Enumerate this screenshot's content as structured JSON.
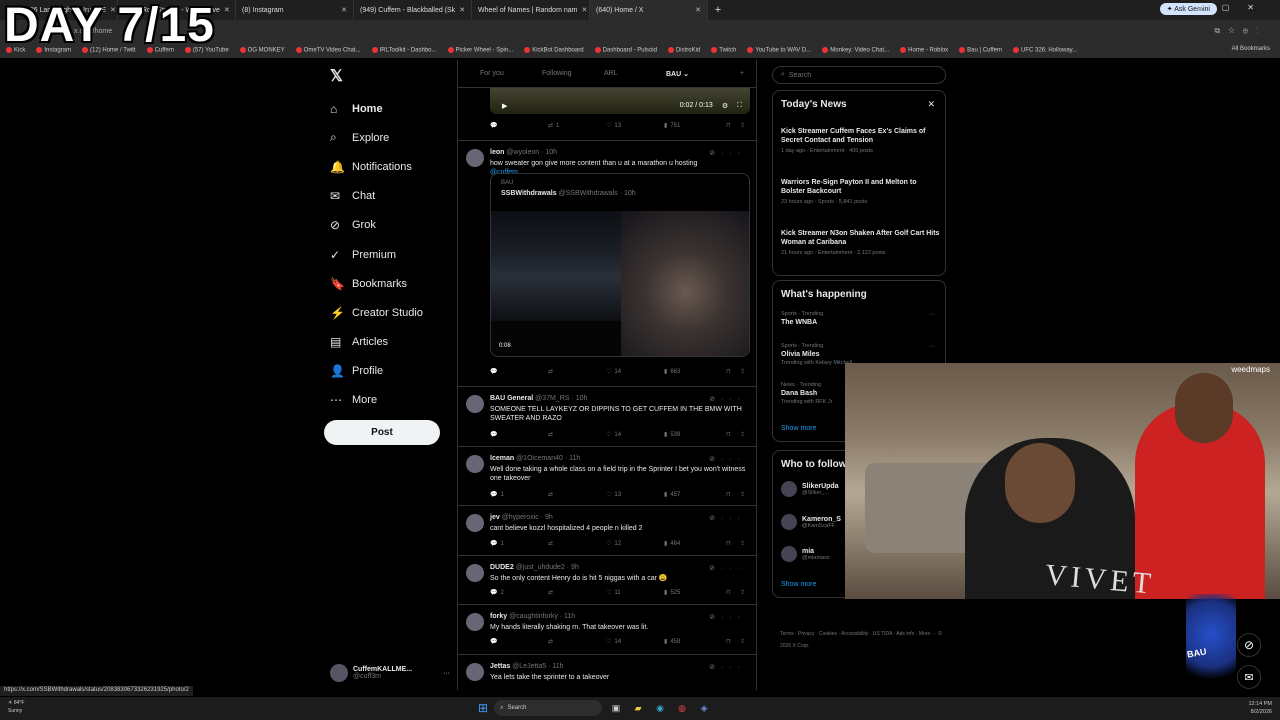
{
  "overlay": {
    "day": "DAY 7/15"
  },
  "browser": {
    "tabs": [
      {
        "label": "New 2026 Lamborghini Urus SE",
        "active": false
      },
      {
        "label": "SquidRon Stream - Watch Live",
        "active": false
      },
      {
        "label": "(8) Instagram",
        "active": false
      },
      {
        "label": "(949) Cuffem - Blackballed (Sk",
        "active": false
      },
      {
        "label": "Wheel of Names | Random nam",
        "active": false
      },
      {
        "label": "(640) Home / X",
        "active": true
      }
    ],
    "ask_gemini": "Ask Gemini",
    "address": "x.com/home",
    "bookmarks": [
      "Kick",
      "Instagram",
      "(12) Home / Twitt",
      "Cuffem",
      "(57) YouTube",
      "OG MONKEY",
      "OmeTV Video Chat...",
      "IRLToolkit - Dashbo...",
      "Picker Wheel - Spin...",
      "KickBot Dashboard",
      "Dashboard - Pulsoid",
      "DistroKid",
      "Twitch",
      "YouTube to WAV D...",
      "Monkey: Video Chat...",
      "Home - Roblox",
      "Bau | Cuffem",
      "UFC 326: Holloway..."
    ],
    "all_bookmarks": "All Bookmarks",
    "status_url": "https://x.com/SSBWithdrawals/status/2083830673326231925/photo/2"
  },
  "sidebar": {
    "logo": "𝕏",
    "items": [
      {
        "label": "Home",
        "icon": "⌂"
      },
      {
        "label": "Explore",
        "icon": "⌕"
      },
      {
        "label": "Notifications",
        "icon": "🔔"
      },
      {
        "label": "Chat",
        "icon": "✉"
      },
      {
        "label": "Grok",
        "icon": "⊘"
      },
      {
        "label": "Premium",
        "icon": "✓"
      },
      {
        "label": "Bookmarks",
        "icon": "🔖"
      },
      {
        "label": "Creator Studio",
        "icon": "⚡"
      },
      {
        "label": "Articles",
        "icon": "▤"
      },
      {
        "label": "Profile",
        "icon": "👤"
      },
      {
        "label": "More",
        "icon": "⋯"
      }
    ],
    "post": "Post",
    "account": {
      "name": "CuffemKALLME...",
      "handle": "@cuff3m"
    }
  },
  "timeline": {
    "tabs": [
      "For you",
      "Following",
      "ARL",
      "BAU ⌄"
    ],
    "plus": "+",
    "video": {
      "time": "0:02 / 0:13"
    },
    "first_actions": {
      "replies": "",
      "rts": "1",
      "likes": "13",
      "views": "751"
    },
    "tweets": [
      {
        "name": "leon",
        "handle": "@wyoleon · 10h",
        "text": "how sweater gon give more content than u at a marathon u hosting",
        "mention": "@cuffem",
        "replies": "",
        "rts": "",
        "likes": "14",
        "views": "663",
        "quote": {
          "context": "BAU",
          "name": "SSBWithdrawals",
          "handle": "@SSBWithdrawals · 10h",
          "duration": "0:08"
        }
      },
      {
        "name": "BAU General",
        "handle": "@37M_RS · 10h",
        "text": "SOMEONE TELL LAYKEYZ OR DIPPINS TO GET CUFFEM IN THE BMW WITH SWEATER AND RAZO",
        "replies": "",
        "rts": "",
        "likes": "14",
        "views": "539"
      },
      {
        "name": "Iceman",
        "handle": "@1Oiceman40 · 11h",
        "text": "Well done taking a whole class on a field trip in the Sprinter I bet you won't witness one takeover",
        "replies": "1",
        "rts": "",
        "likes": "13",
        "views": "457"
      },
      {
        "name": "jev",
        "handle": "@hyperoxic · 9h",
        "text": "cant believe kozzl hospitalized 4 people n killed 2",
        "replies": "1",
        "rts": "",
        "likes": "12",
        "views": "464"
      },
      {
        "name": "DUDE2",
        "handle": "@just_uhdude2 · 9h",
        "text": "So the only content Henry do is hit 5 niggas with a car 😩",
        "replies": "2",
        "rts": "",
        "likes": "11",
        "views": "525"
      },
      {
        "name": "forky",
        "handle": "@caughtinforky · 11h",
        "text": "My hands literally shaking rn. That takeover was lit.",
        "replies": "",
        "rts": "",
        "likes": "14",
        "views": "458"
      },
      {
        "name": "Jettas",
        "handle": "@LeJetta5 · 11h",
        "text": "Yea lets take the sprinter to a takeover"
      }
    ]
  },
  "right": {
    "search_placeholder": "Search",
    "news": {
      "title": "Today's News",
      "items": [
        {
          "headline": "Kick Streamer Cuffem Faces Ex's Claims of Secret Contact and Tension",
          "meta": "1 day ago · Entertainment · 405 posts"
        },
        {
          "headline": "Warriors Re-Sign Payton II and Melton to Bolster Backcourt",
          "meta": "23 hours ago · Sports · 5,841 posts"
        },
        {
          "headline": "Kick Streamer N3on Shaken After Golf Cart Hits Woman at Caribana",
          "meta": "21 hours ago · Entertainment · 2,122 posts"
        }
      ]
    },
    "happening": {
      "title": "What's happening",
      "trends": [
        {
          "category": "Sports · Trending",
          "name": "The WNBA",
          "extra": ""
        },
        {
          "category": "Sports · Trending",
          "name": "Olivia Miles",
          "extra": "Trending with Kelsey Mitchell, ..."
        },
        {
          "category": "News · Trending",
          "name": "Dana Bash",
          "extra": "Trending with RFK Jr"
        }
      ],
      "show_more": "Show more"
    },
    "follow": {
      "title": "Who to follow",
      "users": [
        {
          "name": "SlikerUpda",
          "handle": "@Sliker_..."
        },
        {
          "name": "Kameron_S",
          "handle": "@KamScaFF"
        },
        {
          "name": "mia",
          "handle": "@miamaxx"
        }
      ],
      "show_more": "Show more"
    },
    "footer": "Terms · Privacy · Cookies · Accessibility · US TIDA · Ads info · More ··· © 2026 X Corp."
  },
  "webcam": {
    "text": "VIVET",
    "logo": "weedmaps",
    "cap": "BAU"
  },
  "mascot": {
    "text": "BAU"
  },
  "taskbar": {
    "weather_temp": "84°F",
    "weather_desc": "Sunny",
    "search": "Search",
    "time": "12:14 PM",
    "date": "8/2/2026"
  }
}
